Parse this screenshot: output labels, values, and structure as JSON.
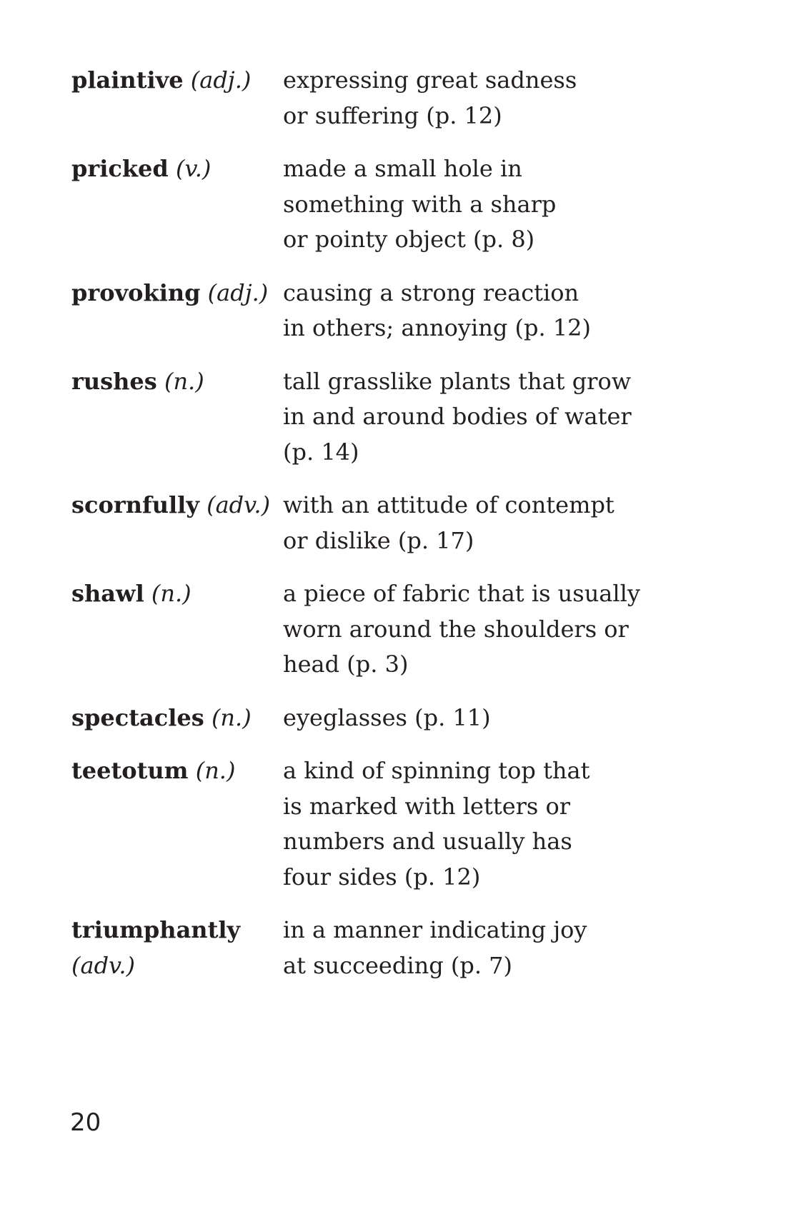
{
  "glossary": {
    "entries": [
      {
        "term": "plaintive",
        "pos": "(adj.)",
        "definition_lines": [
          "expressing great sadness",
          "or suffering (p. 12)"
        ]
      },
      {
        "term": "pricked",
        "pos": "(v.)",
        "definition_lines": [
          "made a small hole in",
          "something with a sharp",
          "or pointy object (p. 8)"
        ]
      },
      {
        "term": "provoking",
        "pos": "(adj.)",
        "definition_lines": [
          "causing a strong reaction",
          "in others; annoying (p. 12)"
        ]
      },
      {
        "term": "rushes",
        "pos": "(n.)",
        "definition_lines": [
          "tall grasslike plants that grow",
          "in and around bodies of water",
          "(p. 14)"
        ]
      },
      {
        "term": "scornfully",
        "pos": "(adv.)",
        "definition_lines": [
          "with an attitude of contempt",
          "or dislike (p. 17)"
        ]
      },
      {
        "term": "shawl",
        "pos": "(n.)",
        "definition_lines": [
          "a piece of fabric that is usually",
          "worn around the shoulders or",
          "head (p. 3)"
        ]
      },
      {
        "term": "spectacles",
        "pos": "(n.)",
        "definition_lines": [
          "eyeglasses (p. 11)"
        ]
      },
      {
        "term": "teetotum",
        "pos": "(n.)",
        "definition_lines": [
          "a kind of spinning top that",
          "is marked with letters or",
          "numbers and usually has",
          "four sides (p. 12)"
        ]
      },
      {
        "term": "triumphantly",
        "pos": "(adv.)",
        "definition_lines": [
          "in a manner indicating joy",
          "at succeeding (p. 7)"
        ]
      }
    ]
  },
  "page_number": "20"
}
